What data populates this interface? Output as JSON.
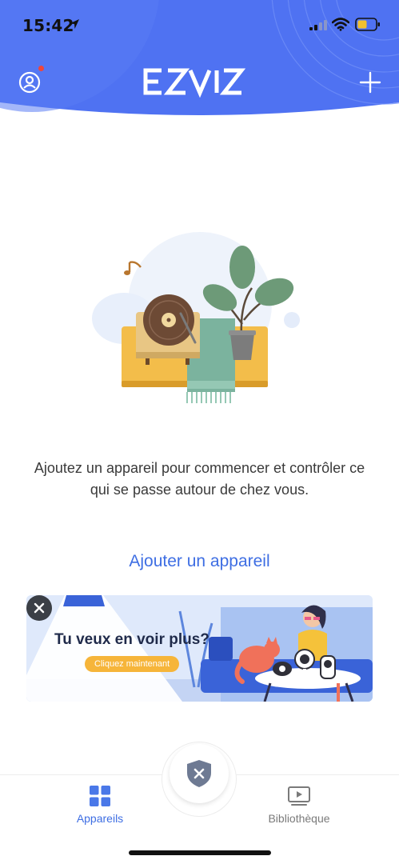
{
  "status_bar": {
    "time": "15:42"
  },
  "header": {
    "brand": "EZVIZ",
    "accent_color": "#4f72f2",
    "profile_icon": "user-circle-icon",
    "add_icon": "plus-icon",
    "has_notification": true
  },
  "empty_state": {
    "message": "Ajoutez un appareil pour commencer et contrôler ce qui se passe autour de chez vous.",
    "action_label": "Ajouter un appareil"
  },
  "banner": {
    "title": "Tu veux en voir plus?",
    "cta_label": "Cliquez maintenant",
    "cta_color": "#f6b53a"
  },
  "tabbar": {
    "tabs": [
      {
        "label": "Appareils",
        "icon": "grid-icon",
        "active": true
      },
      {
        "label": "Bibliothèque",
        "icon": "play-library-icon",
        "active": false
      }
    ],
    "center_icon": "shield-x-icon",
    "active_color": "#3e6ee3"
  }
}
